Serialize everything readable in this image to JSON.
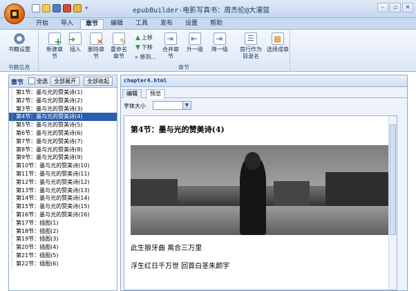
{
  "window": {
    "title": "epubBuilder-电影写真书：周杰伦@大灌篮"
  },
  "ribbon_tabs": [
    "开始",
    "导入",
    "章节",
    "编辑",
    "工具",
    "发布",
    "设置",
    "帮助"
  ],
  "ribbon": {
    "book_group_label": "书籍信息",
    "book_settings": "书籍设置",
    "new_chapter": "新建章节",
    "insert": "插入",
    "delete_chapter": "删除章节",
    "rename": "重命名章节",
    "move_up": "上移",
    "move_down": "下移",
    "move_to": "移到...",
    "merge_chapter": "合并章节",
    "promote": "升一级",
    "demote": "降一级",
    "first_line_as_dir": "首行作为目录名",
    "select_chapter": "选择成章",
    "chapter_group_label": "章节"
  },
  "left_panel": {
    "title": "章节",
    "select_all": "全选",
    "expand_all": "全部展开",
    "collapse_all": "全部收起",
    "items": [
      "第1节：墨与光的赞美诗(1)",
      "第2节：墨与光的赞美诗(2)",
      "第3节：墨与光的赞美诗(3)",
      "第4节：墨与光的赞美诗(4)",
      "第5节：墨与光的赞美诗(5)",
      "第6节：墨与光的赞美诗(6)",
      "第7节：墨与光的赞美诗(7)",
      "第8节：墨与光的赞美诗(8)",
      "第9节：墨与光的赞美诗(9)",
      "第10节：墨与光的赞美诗(10)",
      "第11节：墨与光的赞美诗(11)",
      "第12节：墨与光的赞美诗(12)",
      "第13节：墨与光的赞美诗(13)",
      "第14节：墨与光的赞美诗(14)",
      "第15节：墨与光的赞美诗(15)",
      "第16节：墨与光的赞美诗(16)",
      "第17节：插图(1)",
      "第18节：插图(2)",
      "第19节：插图(3)",
      "第20节：插图(4)",
      "第21节：插图(5)",
      "第22节：插图(6)"
    ],
    "selected_index": 3
  },
  "right_panel": {
    "file_name": "chapter4.html",
    "tabs": [
      "编辑",
      "预览"
    ],
    "active_tab": 1,
    "font_size_label": "字体大小",
    "font_size_value": "",
    "doc_title": "第4节：墨与光的赞美诗(4)",
    "doc_lines": [
      "此生狼牙曲  离合三万里",
      "浮生红日千万世  回首白茎朱颜宇"
    ]
  },
  "colors": {
    "selection": "#2b5fad",
    "ribbon_bg": "#dbe7f6",
    "accent": "#1b3d78"
  }
}
